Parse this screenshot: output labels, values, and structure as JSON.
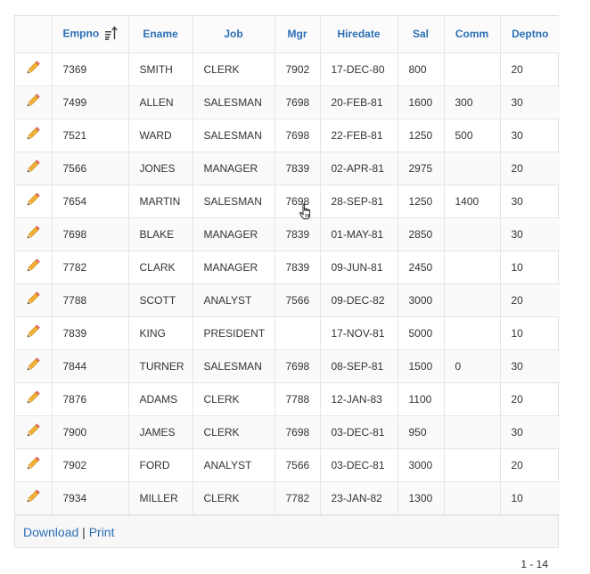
{
  "table": {
    "columns": [
      {
        "key": "edit",
        "label": ""
      },
      {
        "key": "empno",
        "label": "Empno",
        "sorted": "ascending"
      },
      {
        "key": "ename",
        "label": "Ename"
      },
      {
        "key": "job",
        "label": "Job"
      },
      {
        "key": "mgr",
        "label": "Mgr"
      },
      {
        "key": "hiredate",
        "label": "Hiredate"
      },
      {
        "key": "sal",
        "label": "Sal"
      },
      {
        "key": "comm",
        "label": "Comm"
      },
      {
        "key": "deptno",
        "label": "Deptno"
      }
    ],
    "rows": [
      {
        "empno": "7369",
        "ename": "SMITH",
        "job": "CLERK",
        "mgr": "7902",
        "hiredate": "17-DEC-80",
        "sal": "800",
        "comm": "",
        "deptno": "20"
      },
      {
        "empno": "7499",
        "ename": "ALLEN",
        "job": "SALESMAN",
        "mgr": "7698",
        "hiredate": "20-FEB-81",
        "sal": "1600",
        "comm": "300",
        "deptno": "30"
      },
      {
        "empno": "7521",
        "ename": "WARD",
        "job": "SALESMAN",
        "mgr": "7698",
        "hiredate": "22-FEB-81",
        "sal": "1250",
        "comm": "500",
        "deptno": "30"
      },
      {
        "empno": "7566",
        "ename": "JONES",
        "job": "MANAGER",
        "mgr": "7839",
        "hiredate": "02-APR-81",
        "sal": "2975",
        "comm": "",
        "deptno": "20"
      },
      {
        "empno": "7654",
        "ename": "MARTIN",
        "job": "SALESMAN",
        "mgr": "7698",
        "hiredate": "28-SEP-81",
        "sal": "1250",
        "comm": "1400",
        "deptno": "30"
      },
      {
        "empno": "7698",
        "ename": "BLAKE",
        "job": "MANAGER",
        "mgr": "7839",
        "hiredate": "01-MAY-81",
        "sal": "2850",
        "comm": "",
        "deptno": "30"
      },
      {
        "empno": "7782",
        "ename": "CLARK",
        "job": "MANAGER",
        "mgr": "7839",
        "hiredate": "09-JUN-81",
        "sal": "2450",
        "comm": "",
        "deptno": "10"
      },
      {
        "empno": "7788",
        "ename": "SCOTT",
        "job": "ANALYST",
        "mgr": "7566",
        "hiredate": "09-DEC-82",
        "sal": "3000",
        "comm": "",
        "deptno": "20"
      },
      {
        "empno": "7839",
        "ename": "KING",
        "job": "PRESIDENT",
        "mgr": "",
        "hiredate": "17-NOV-81",
        "sal": "5000",
        "comm": "",
        "deptno": "10"
      },
      {
        "empno": "7844",
        "ename": "TURNER",
        "job": "SALESMAN",
        "mgr": "7698",
        "hiredate": "08-SEP-81",
        "sal": "1500",
        "comm": "0",
        "deptno": "30"
      },
      {
        "empno": "7876",
        "ename": "ADAMS",
        "job": "CLERK",
        "mgr": "7788",
        "hiredate": "12-JAN-83",
        "sal": "1100",
        "comm": "",
        "deptno": "20"
      },
      {
        "empno": "7900",
        "ename": "JAMES",
        "job": "CLERK",
        "mgr": "7698",
        "hiredate": "03-DEC-81",
        "sal": "950",
        "comm": "",
        "deptno": "30"
      },
      {
        "empno": "7902",
        "ename": "FORD",
        "job": "ANALYST",
        "mgr": "7566",
        "hiredate": "03-DEC-81",
        "sal": "3000",
        "comm": "",
        "deptno": "20"
      },
      {
        "empno": "7934",
        "ename": "MILLER",
        "job": "CLERK",
        "mgr": "7782",
        "hiredate": "23-JAN-82",
        "sal": "1300",
        "comm": "",
        "deptno": "10"
      }
    ]
  },
  "footer": {
    "download_label": "Download",
    "separator": "|",
    "print_label": "Print"
  },
  "pagination": {
    "range": "1 - 14"
  },
  "icons": {
    "edit": "pencil-icon",
    "sort": "sort-ascending-icon",
    "cursor": "hand-pointer-icon"
  },
  "colors": {
    "header_link": "#2a6fb6",
    "link": "#2a6fb6"
  }
}
